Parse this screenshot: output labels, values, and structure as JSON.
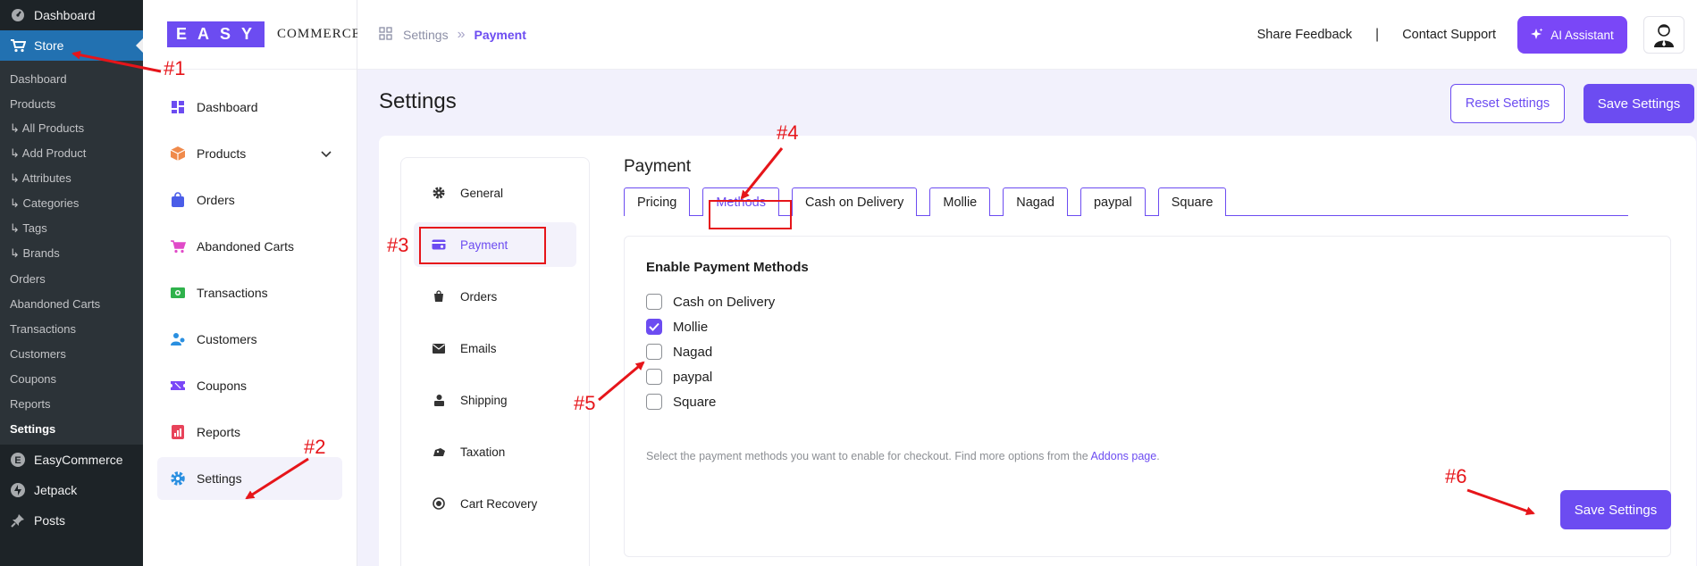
{
  "wp_sidebar": {
    "top_items": [
      {
        "label": "Dashboard",
        "icon": "speedometer-icon"
      },
      {
        "label": "Store",
        "icon": "cart-icon"
      }
    ],
    "store_submenu": [
      "Dashboard",
      "Products",
      "↳ All Products",
      "↳ Add Product",
      "↳ Attributes",
      "↳ Categories",
      "↳ Tags",
      "↳ Brands",
      "Orders",
      "Abandoned Carts",
      "Transactions",
      "Customers",
      "Coupons",
      "Reports",
      "Settings"
    ],
    "bottom_items": [
      {
        "label": "EasyCommerce",
        "icon": "easycommerce-e-icon"
      },
      {
        "label": "Jetpack",
        "icon": "jetpack-bolt-icon"
      },
      {
        "label": "Posts",
        "icon": "pushpin-icon"
      }
    ]
  },
  "ec_logo": {
    "box": "EASY",
    "text": "COMMERCE"
  },
  "ec_nav": [
    {
      "label": "Dashboard",
      "icon": "dashboard-grid-icon"
    },
    {
      "label": "Products",
      "icon": "box-icon"
    },
    {
      "label": "Orders",
      "icon": "shopping-bag-icon"
    },
    {
      "label": "Abandoned Carts",
      "icon": "cart-icon"
    },
    {
      "label": "Transactions",
      "icon": "cash-icon"
    },
    {
      "label": "Customers",
      "icon": "users-icon"
    },
    {
      "label": "Coupons",
      "icon": "coupon-icon"
    },
    {
      "label": "Reports",
      "icon": "report-icon"
    },
    {
      "label": "Settings",
      "icon": "gear-icon"
    }
  ],
  "breadcrumb": {
    "parent": "Settings",
    "separator": "»",
    "current": "Payment"
  },
  "header": {
    "share_feedback": "Share Feedback",
    "pipe": "|",
    "contact_support": "Contact Support",
    "ai_assistant": "AI Assistant"
  },
  "page": {
    "title": "Settings",
    "reset_label": "Reset Settings",
    "save_label": "Save Settings"
  },
  "settings_nav": [
    {
      "label": "General",
      "icon": "gear-icon"
    },
    {
      "label": "Payment",
      "icon": "payment-card-icon"
    },
    {
      "label": "Orders",
      "icon": "bag-icon"
    },
    {
      "label": "Emails",
      "icon": "envelope-icon"
    },
    {
      "label": "Shipping",
      "icon": "shipping-icon"
    },
    {
      "label": "Taxation",
      "icon": "tax-icon"
    },
    {
      "label": "Cart Recovery",
      "icon": "recovery-icon"
    }
  ],
  "payment": {
    "title": "Payment",
    "tabs": [
      "Pricing",
      "Methods",
      "Cash on Delivery",
      "Mollie",
      "Nagad",
      "paypal",
      "Square"
    ],
    "active_tab": "Methods",
    "methods_title": "Enable Payment Methods",
    "methods": [
      {
        "label": "Cash on Delivery",
        "checked": false
      },
      {
        "label": "Mollie",
        "checked": true
      },
      {
        "label": "Nagad",
        "checked": false
      },
      {
        "label": "paypal",
        "checked": false
      },
      {
        "label": "Square",
        "checked": false
      }
    ],
    "help_text": "Select the payment methods you want to enable for checkout. Find more options from the",
    "help_link": "Addons page",
    "help_end": ".",
    "save_label": "Save Settings"
  },
  "annotations": [
    "#1",
    "#2",
    "#3",
    "#4",
    "#5",
    "#6"
  ],
  "colors": {
    "accent": "#6c4cf1",
    "annotation": "#e6151a",
    "wp_sidebar": "#1d2327",
    "wp_active": "#2271b1"
  }
}
